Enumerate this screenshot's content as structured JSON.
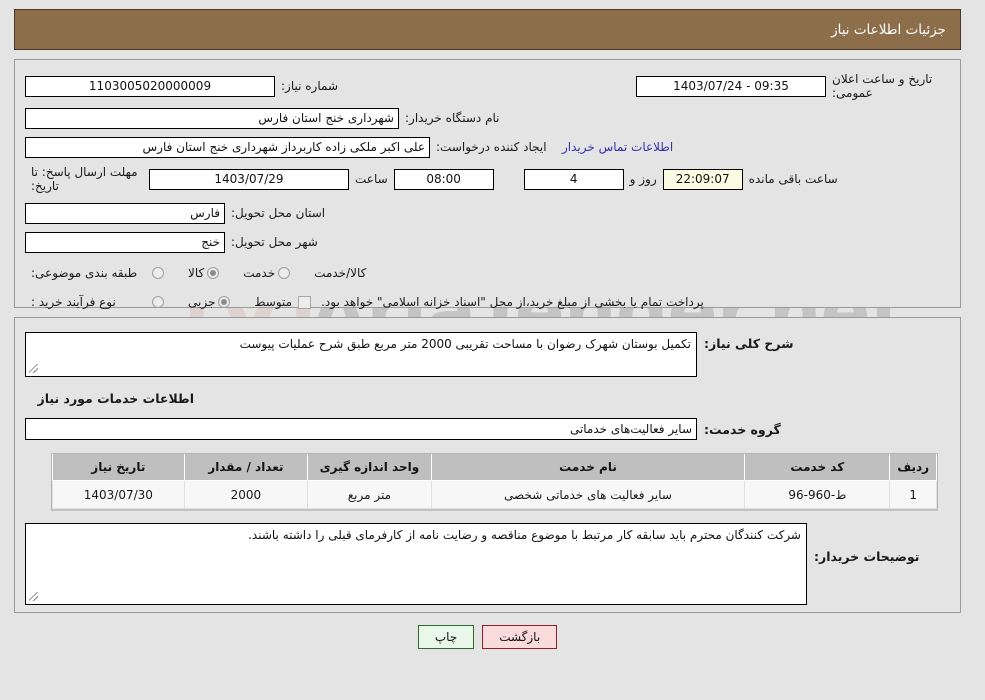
{
  "header": {
    "title": "جزئیات اطلاعات نیاز",
    "bg_color": "#8d6e4b"
  },
  "watermark": {
    "text": "AriaTender.net"
  },
  "form": {
    "need_number": {
      "label": "شماره نیاز:",
      "value": "1103005020000009"
    },
    "public_announce": {
      "label": "تاریخ و ساعت اعلان عمومی:",
      "value": "09:35 - 1403/07/24"
    },
    "buyer_org": {
      "label": "نام دستگاه خریدار:",
      "value": "شهرداری خنج استان فارس"
    },
    "creator": {
      "label": "ایجاد کننده درخواست:",
      "value": "علی اکبر ملکی زاده کاربرداز شهرداری خنج استان فارس"
    },
    "contact_link": {
      "label": "اطلاعات تماس خریدار",
      "color": "#3a2fb0"
    },
    "deadline": {
      "label": "مهلت ارسال پاسخ: تا تاریخ:",
      "date": "1403/07/29",
      "time_label": "ساعت",
      "time": "08:00",
      "days": "4",
      "days_label": "روز و",
      "remaining": "22:09:07",
      "remaining_label": "ساعت باقی مانده",
      "remaining_bg": "#fbfbe4"
    },
    "province": {
      "label": "استان محل تحویل:",
      "value": "فارس"
    },
    "city": {
      "label": "شهر محل تحویل:",
      "value": "خنج"
    },
    "category": {
      "label": "طبقه بندی موضوعی:",
      "options": [
        {
          "label": "کالا",
          "selected": false
        },
        {
          "label": "خدمت",
          "selected": true
        },
        {
          "label": "کالا/خدمت",
          "selected": false
        }
      ]
    },
    "process_type": {
      "label": "نوع فرآیند خرید :",
      "options": [
        {
          "label": "جزیی",
          "selected": false
        },
        {
          "label": "متوسط",
          "selected": true
        }
      ],
      "treasury_checkbox": {
        "checked": false,
        "note": "پرداخت تمام یا بخشی از مبلغ خرید،از محل \"اسناد خزانه اسلامی\" خواهد بود."
      }
    }
  },
  "need_description": {
    "label": "شرح کلی نیاز:",
    "value": "تکمیل بوستان شهرک رضوان با مساحت تقریبی 2000 متر مربع طبق شرح عملیات پیوست"
  },
  "services_section": {
    "title": "اطلاعات خدمات مورد نیاز",
    "service_group": {
      "label": "گروه خدمت:",
      "value": "سایر فعالیت‌های خدماتی"
    }
  },
  "table": {
    "columns": [
      "ردیف",
      "کد خدمت",
      "نام خدمت",
      "واحد اندازه گیری",
      "تعداد / مقدار",
      "تاریخ نیاز"
    ],
    "rows": [
      {
        "radif": "1",
        "code": "ط-960-96",
        "name": "سایر فعالیت های خدماتی شخصی",
        "unit": "متر مربع",
        "qty": "2000",
        "date": "1403/07/30"
      }
    ]
  },
  "buyer_notes": {
    "label": "توضیحات خریدار:",
    "value": "شرکت کنندگان محترم باید سابقه کار مرتبط با موضوع مناقصه و رضایت نامه از کارفرمای قبلی را داشته باشند."
  },
  "buttons": {
    "print": {
      "label": "چاپ",
      "bg": "#e9f7e9"
    },
    "back": {
      "label": "بازگشت",
      "bg": "#fadbdb"
    }
  }
}
